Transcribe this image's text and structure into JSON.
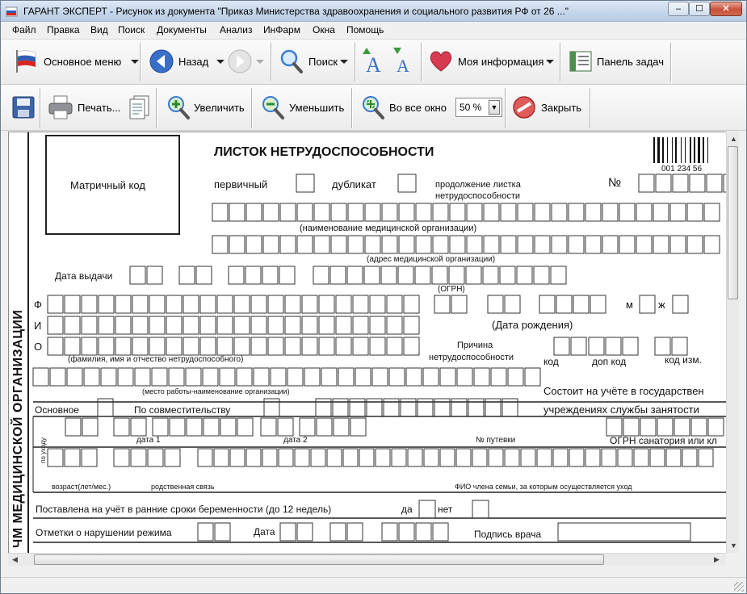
{
  "window": {
    "title": "ГАРАНТ ЭКСПЕРТ - Рисунок из документа \"Приказ Министерства здравоохранения и социального развития РФ от 26 ...\"",
    "minimize_label": "–",
    "maximize_label": "☐",
    "close_label": "✕"
  },
  "menu": [
    "Файл",
    "Правка",
    "Вид",
    "Поиск",
    "Документы",
    "Анализ",
    "ИнФарм",
    "Окна",
    "Помощь"
  ],
  "toolbar1": {
    "main_menu": "Основное меню",
    "back": "Назад",
    "search": "Поиск",
    "my_info": "Моя информация",
    "taskbar": "Панель задач"
  },
  "toolbar2": {
    "print": "Печать...",
    "zoom_in": "Увеличить",
    "zoom_out": "Уменьшить",
    "fit_window": "Во все окно",
    "zoom_value": "50 %",
    "close": "Закрыть"
  },
  "form": {
    "heading": "ЛИСТОК НЕТРУДОСПОСОБНОСТИ",
    "matrix_code": "Матричный код",
    "barcode_digits": "001  234  56",
    "primary": "первичный",
    "duplicate": "дубликат",
    "continuation_1": "продолжение листка",
    "continuation_2": "нетрудоспособности",
    "number_sign": "№",
    "med_org_name": "(наименование медицинской организации)",
    "med_org_address": "(адрес медицинской организации)",
    "issue_date": "Дата выдачи",
    "ogrn": "(ОГРН)",
    "letter_f": "Ф",
    "letter_i": "И",
    "letter_o": "О",
    "male": "м",
    "female": "ж",
    "birth_date": "(Дата рождения)",
    "reason_1": "Причина",
    "reason_2": "нетрудоспособности",
    "code": "код",
    "extra_code": "доп код",
    "changed_code": "код изм.",
    "full_name": "(фамилия, имя и отчество нетрудоспособного)",
    "workplace": "(место работы-наименование организации)",
    "employment_1": "Состоит на учёте в государствен",
    "employment_2": "учреждениях службы занятости",
    "main_job": "Основное",
    "part_time": "По совместительству",
    "date1": "дата 1",
    "date2": "дата 2",
    "voucher_no": "№ путевки",
    "sanatorium_ogrn": "ОГРН санатория или кл",
    "care": "по уходу",
    "age": "возраст(лет/мес.)",
    "kinship": "родственная связь",
    "family_member": "ФИО члена семьи, за которым осуществляется уход",
    "pregnancy": "Поставлена на учёт в ранние сроки беременности (до 12 недель)",
    "yes": "да",
    "no": "нет",
    "violations": "Отметки о нарушении режима",
    "date": "Дата",
    "doctor_signature": "Подпись врача",
    "vertical_org": "ЧМ МЕДИЦИНСКОЙ ОРГАНИЗАЦИИ"
  }
}
